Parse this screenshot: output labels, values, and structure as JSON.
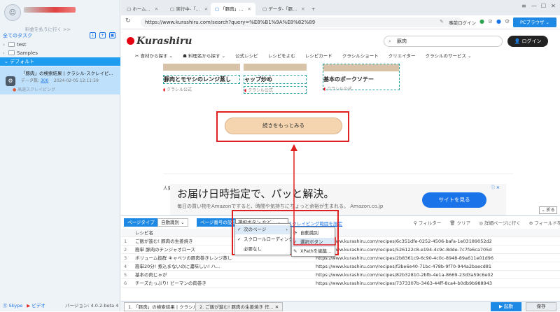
{
  "left": {
    "plan_link": "料金を払うに行く >>",
    "tasks_header": "全てのタスク",
    "tree": [
      {
        "label": "test"
      },
      {
        "label": "Samples"
      }
    ],
    "default_group": "デフォルト",
    "task": {
      "title": "「豚肉」の検索結果 | クラシル-スクレイピ...",
      "meta_prefix": "データ数:",
      "meta_count": "300",
      "meta_time": "2024-02-05 12:11:59",
      "sub": "高速スクレイピング"
    },
    "footer": {
      "skype": "Skype",
      "video": "ビデオ",
      "version": "バージョン: 4.0.2-beta 4"
    }
  },
  "browser": {
    "tabs": [
      {
        "label": "ホーム..."
      },
      {
        "label": "実行中-「..."
      },
      {
        "label": "「豚肉」..."
      },
      {
        "label": "データ-「豚..."
      }
    ],
    "url": "https://www.kurashiru.com/search?query=%E8%B1%9A%E8%82%89",
    "right_controls": {
      "login_first": "事前ログイン",
      "pc_browser": "PCブラウザ"
    }
  },
  "site": {
    "logo": "Kurashiru",
    "search_value": "豚肉",
    "login": "ログイン",
    "nav": [
      "食材から探す",
      "料理名から探す",
      "公式レシピ",
      "レシピをよむ",
      "レシピカード",
      "クラシルショート",
      "クリエイター",
      "クラシルのサービス"
    ],
    "cards": [
      {
        "title": "豚肉とモヤシのレンジ蒸し",
        "sub": "クラシル公式"
      },
      {
        "title": "ャップ炒め",
        "sub": "クラシル公式"
      },
      {
        "title": "基本のポークソテー",
        "sub": "クラシル公式"
      }
    ],
    "more_button": "続きをもっとみる",
    "popular_label": "人気",
    "ad": {
      "headline": "お届け日時指定で、パッと解決。",
      "sub": "毎日の買い物をAmazonですると、時間や気持ちにちょっと余裕が生まれる。 Amazon.co.jp",
      "cta": "サイトを見る"
    },
    "fold": "折る"
  },
  "panel": {
    "page_type_btn": "ページタイプ",
    "page_type_value": "自動識別",
    "page_num_btn": "ページ番号の設定",
    "select_mode": "選択ボタン など...",
    "scope_link": "スクレイピング範囲を設定",
    "tools": [
      "フィルター",
      "クリア",
      "詳細ページに行く",
      "フィールドを追加"
    ],
    "column_header": "レシピ名",
    "rows": [
      {
        "num": "1",
        "name": "ご飯が進む! 豚肉の生姜焼き",
        "url": "https://www.kurashiru.com/recipes/6c351dfe-0252-4506-bafa-1e03189052d2"
      },
      {
        "num": "2",
        "name": "簡単 豚肉のチンジャオロース",
        "url": "https://www.kurashiru.com/recipes/526122c8-e194-4c9c-8dde-7c7fe6ca705d"
      },
      {
        "num": "3",
        "name": "ボリューム抜群 キャベツの豚肉巻きレンジ蒸し",
        "url": "https://www.kurashiru.com/recipes/2b8361c9-6c90-4c0c-8948-89a611e01d96"
      },
      {
        "num": "4",
        "name": "簡単20分! 煮込まないのに濃味しい! ハ...",
        "url": "https://www.kurashiru.com/recipes/f3be6e40-71bc-478b-9f70-944a2baecd81"
      },
      {
        "num": "5",
        "name": "基本の肉じゃが",
        "url": "https://www.kurashiru.com/recipes/82b32810-2bfb-4e1a-8669-23d3a59c6e02"
      },
      {
        "num": "6",
        "name": "チーズたっぷり! ピーマンの肉巻き",
        "url": "https://www.kurashiru.com/recipes/7373307b-3463-44ff-8ca4-b0db9b988943"
      }
    ],
    "menu1": [
      "次のページ",
      "スクロールローディング",
      "必要なし"
    ],
    "menu2": [
      "自動識別",
      "選択ボタン",
      "XPathを編集..."
    ]
  },
  "footer": {
    "tab1": "1. 「豚肉」の検索結果 | クラシル",
    "tab2": "2. ご飯が進む! 豚肉の生姜焼き 作...",
    "start": "起動",
    "save": "保存"
  },
  "colors": {
    "accent": "#1e88e5",
    "highlight_box": "#e02020",
    "selected_task": "#bfe0fb",
    "default_row": "#1e9cf0"
  }
}
